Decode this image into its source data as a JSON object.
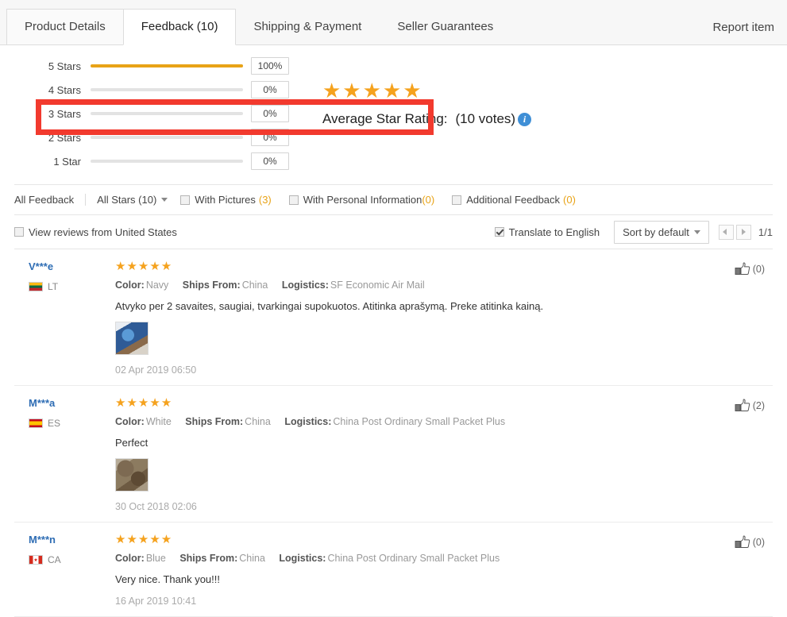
{
  "tabs": [
    {
      "label": "Product Details",
      "active": false
    },
    {
      "label": "Feedback (10)",
      "active": true
    },
    {
      "label": "Shipping & Payment",
      "active": false
    },
    {
      "label": "Seller Guarantees",
      "active": false
    }
  ],
  "report_item": "Report item",
  "rating_summary": {
    "rows": [
      {
        "label": "5 Stars",
        "percent": "100%",
        "value": 100
      },
      {
        "label": "4 Stars",
        "percent": "0%",
        "value": 0
      },
      {
        "label": "3 Stars",
        "percent": "0%",
        "value": 0
      },
      {
        "label": "2 Stars",
        "percent": "0%",
        "value": 0
      },
      {
        "label": "1 Star",
        "percent": "0%",
        "value": 0
      }
    ],
    "stars_display": "★★★★★",
    "average_label": "Average Star Rating:",
    "votes": "(10 votes)",
    "info_glyph": "i",
    "bar_color": "#e8a317",
    "star_color": "#f5a21e"
  },
  "highlight": {
    "color": "#f23a2e"
  },
  "filters": {
    "all_feedback": "All Feedback",
    "all_stars": "All Stars (10)",
    "with_pictures_label": "With Pictures",
    "with_pictures_count": "(3)",
    "with_personal_label": "With Personal Information",
    "with_personal_count": "(0)",
    "additional_label": "Additional Feedback",
    "additional_count": "(0)",
    "view_reviews_from": "View reviews from United States",
    "translate_to_english": "Translate to English",
    "sort_by": "Sort by default",
    "page_indicator": "1/1"
  },
  "reviews": [
    {
      "name": "V***e",
      "country_code": "LT",
      "flag": "flag-lt",
      "stars": "★★★★★",
      "color_label": "Color:",
      "color_value": "Navy",
      "ships_label": "Ships From:",
      "ships_value": "China",
      "logistics_label": "Logistics:",
      "logistics_value": "SF Economic Air Mail",
      "text": "Atvyko per 2 savaites, saugiai, tvarkingai supokuotos. Atitinka aprašymą. Preke atitinka kainą.",
      "has_thumb": true,
      "thumb_class": "thumb-navy",
      "date": "02 Apr 2019 06:50",
      "likes": "(0)"
    },
    {
      "name": "M***a",
      "country_code": "ES",
      "flag": "flag-es",
      "stars": "★★★★★",
      "color_label": "Color:",
      "color_value": "White",
      "ships_label": "Ships From:",
      "ships_value": "China",
      "logistics_label": "Logistics:",
      "logistics_value": "China Post Ordinary Small Packet Plus",
      "text": "Perfect",
      "has_thumb": true,
      "thumb_class": "thumb-camo",
      "date": "30 Oct 2018 02:06",
      "likes": "(2)"
    },
    {
      "name": "M***n",
      "country_code": "CA",
      "flag": "flag-ca",
      "stars": "★★★★★",
      "color_label": "Color:",
      "color_value": "Blue",
      "ships_label": "Ships From:",
      "ships_value": "China",
      "logistics_label": "Logistics:",
      "logistics_value": "China Post Ordinary Small Packet Plus",
      "text": "Very nice. Thank you!!!",
      "has_thumb": false,
      "thumb_class": "",
      "date": "16 Apr 2019 10:41",
      "likes": "(0)"
    }
  ]
}
